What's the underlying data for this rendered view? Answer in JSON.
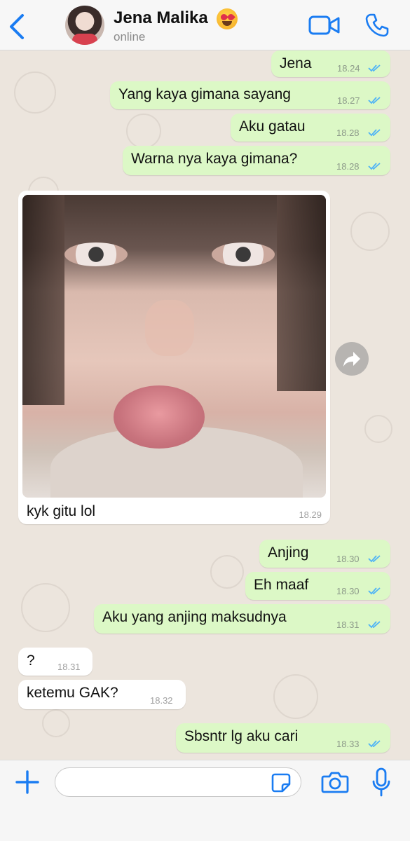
{
  "header": {
    "contact_name": "Jena Malika",
    "status": "online"
  },
  "messages": [
    {
      "dir": "out",
      "text": "Jena",
      "time": "18.24"
    },
    {
      "dir": "out",
      "text": "Yang kaya gimana sayang",
      "time": "18.27"
    },
    {
      "dir": "out",
      "text": "Aku gatau",
      "time": "18.28"
    },
    {
      "dir": "out",
      "text": "Warna nya kaya gimana?",
      "time": "18.28"
    },
    {
      "dir": "in",
      "type": "image",
      "caption": "kyk gitu lol",
      "time": "18.29"
    },
    {
      "dir": "out",
      "text": "Anjing",
      "time": "18.30"
    },
    {
      "dir": "out",
      "text": "Eh maaf",
      "time": "18.30"
    },
    {
      "dir": "out",
      "text": "Aku yang anjing maksudnya",
      "time": "18.31"
    },
    {
      "dir": "in",
      "text": "?",
      "time": "18.31"
    },
    {
      "dir": "in",
      "text": "ketemu GAK?",
      "time": "18.32"
    },
    {
      "dir": "out",
      "text": "Sbsntr lg aku cari",
      "time": "18.33"
    }
  ],
  "input": {
    "placeholder": "",
    "value": ""
  },
  "colors": {
    "accent": "#1a7cf2",
    "outgoing_bubble": "#dcf8c6",
    "incoming_bubble": "#ffffff",
    "chat_background": "#ece5dd",
    "read_ticks": "#4fb3f6"
  },
  "icons": [
    "back-chevron-icon",
    "video-call-icon",
    "phone-call-icon",
    "share-forward-icon",
    "plus-icon",
    "sticker-icon",
    "camera-icon",
    "microphone-icon",
    "double-check-icon"
  ]
}
